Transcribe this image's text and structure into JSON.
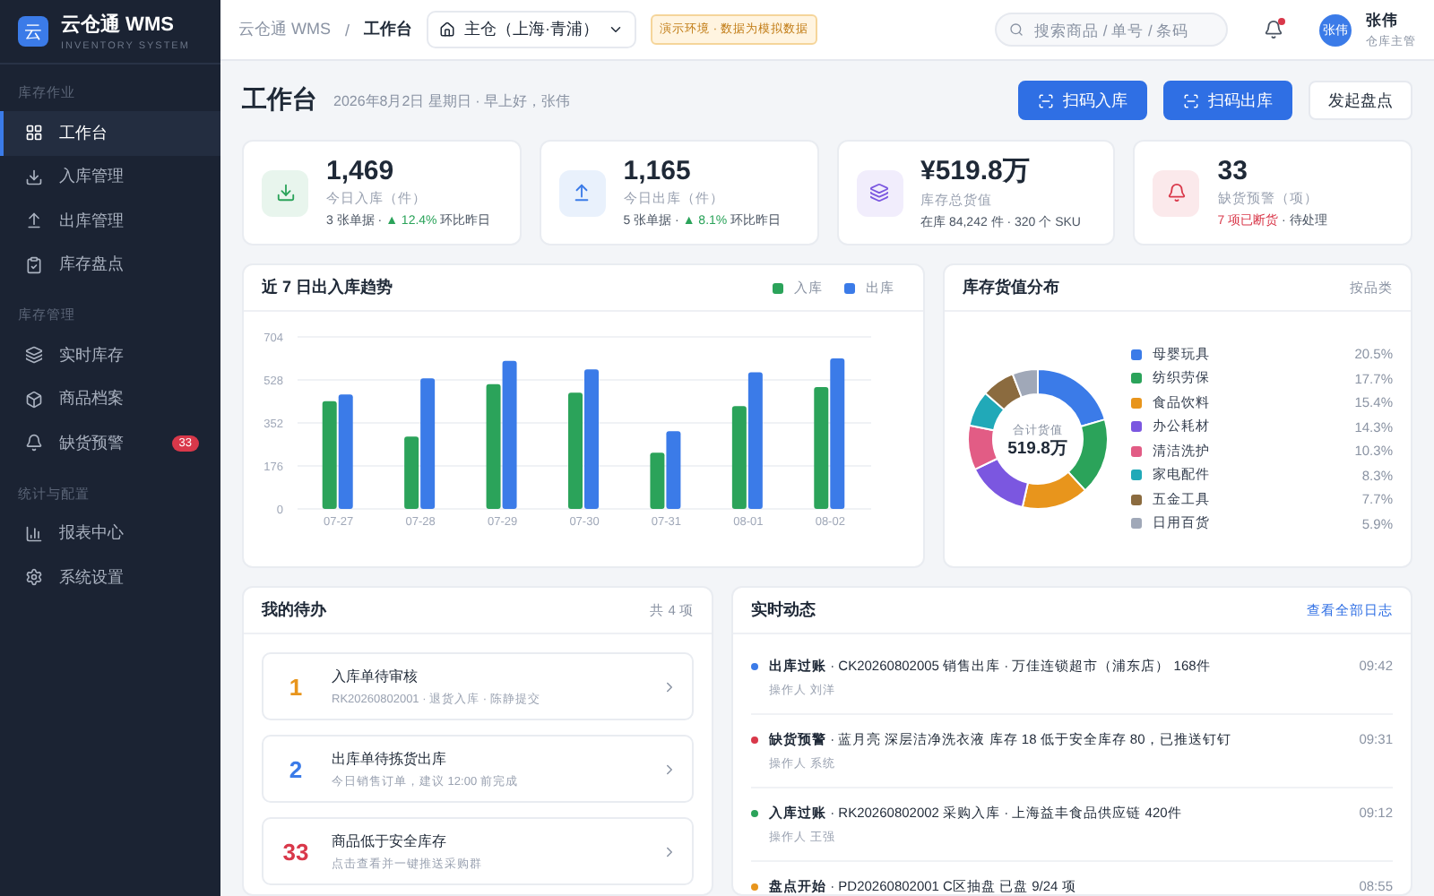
{
  "sidebar": {
    "logo": "云",
    "name": "云仓通 WMS",
    "subtitle": "INVENTORY SYSTEM",
    "sections": [
      {
        "label": "库存作业",
        "items": [
          {
            "label": "工作台",
            "selected": true
          },
          {
            "label": "入库管理",
            "selected": false
          },
          {
            "label": "出库管理",
            "selected": false
          },
          {
            "label": "库存盘点",
            "selected": false
          }
        ]
      },
      {
        "label": "库存管理",
        "items": [
          {
            "label": "实时库存",
            "selected": false
          },
          {
            "label": "商品档案",
            "selected": false
          },
          {
            "label": "缺货预警",
            "selected": false,
            "badge": "33"
          }
        ]
      },
      {
        "label": "统计与配置",
        "items": [
          {
            "label": "报表中心",
            "selected": false
          },
          {
            "label": "系统设置",
            "selected": false
          }
        ]
      }
    ]
  },
  "topbar": {
    "breadcrumb": [
      "云仓通 WMS",
      "工作台"
    ],
    "breadcrumb_separator": "/",
    "warehouse": "主仓（上海·青浦）",
    "env_badge": "演示环境 · 数据为模拟数据",
    "search": {
      "placeholder": "搜索商品 / 单号 / 条码"
    },
    "unread": true,
    "user": {
      "avatar": "张伟",
      "name": "张伟",
      "role": "仓库主管"
    }
  },
  "header": {
    "title": "工作台",
    "subtitle": "2026年8月2日 星期日 · 早上好，张伟",
    "buttons": [
      {
        "label": "扫码入库",
        "kind": "primary"
      },
      {
        "label": "扫码出库",
        "kind": "primary"
      },
      {
        "label": "发起盘点",
        "kind": "secondary"
      }
    ]
  },
  "stats": [
    {
      "value": "1,469",
      "label": "今日入库（件）",
      "color": "#2ba35a",
      "note": "3 张单据 · ",
      "note_trend": "▲ 12.4%",
      "note_suffix": " 环比昨日"
    },
    {
      "value": "1,165",
      "label": "今日出库（件）",
      "color": "#3b7be8",
      "note": "5 张单据 · ",
      "note_trend": "▲ 8.1%",
      "note_suffix": " 环比昨日"
    },
    {
      "value": "¥519.8万",
      "label": "库存总货值",
      "color": "#7b57e0",
      "note": "在库 84,242 件 · 320 个 SKU"
    },
    {
      "value": "33",
      "label": "缺货预警（项）",
      "color": "#d9384a",
      "note_alert": "7 项已断货",
      "note_suffix": " · 待处理"
    }
  ],
  "trend": {
    "title": "近 7 日出入库趋势",
    "chart_data": {
      "type": "bar",
      "grid": true,
      "categories": [
        "07-27",
        "07-28",
        "07-29",
        "07-30",
        "07-31",
        "08-01",
        "08-02"
      ],
      "ylim": [
        0,
        704
      ],
      "yticks": [
        0,
        176,
        352,
        528,
        704
      ],
      "series": [
        {
          "name": "入库",
          "color": "#2ba35a",
          "values": [
            441,
            296,
            511,
            476,
            230,
            421,
            499
          ]
        },
        {
          "name": "出库",
          "color": "#3b7be8",
          "values": [
            468,
            534,
            606,
            571,
            318,
            559,
            616
          ]
        }
      ]
    }
  },
  "distribution": {
    "title": "库存货值分布",
    "aside": "按品类",
    "center_label": "合计货值",
    "center_value": "519.8万",
    "legend": [
      {
        "label": "母婴玩具",
        "share": "20.5%",
        "color": "#3b7be8"
      },
      {
        "label": "纺织劳保",
        "share": "17.7%",
        "color": "#2ba35a"
      },
      {
        "label": "食品饮料",
        "share": "15.4%",
        "color": "#e8951c"
      },
      {
        "label": "办公耗材",
        "share": "14.3%",
        "color": "#7b57e0"
      },
      {
        "label": "清洁洗护",
        "share": "10.3%",
        "color": "#e25c85"
      },
      {
        "label": "家电配件",
        "share": "8.3%",
        "color": "#21a9b8"
      },
      {
        "label": "五金工具",
        "share": "7.7%",
        "color": "#8b6b3f"
      },
      {
        "label": "日用百货",
        "share": "5.9%",
        "color": "#a0a8b8"
      }
    ]
  },
  "todo": {
    "title": "我的待办",
    "count": "共 4 项",
    "items": [
      {
        "number": "1",
        "color": "#e8951c",
        "title": "入库单待审核",
        "subtitle": "RK20260802001 · 退货入库 · 陈静提交"
      },
      {
        "number": "2",
        "color": "#3b7be8",
        "title": "出库单待拣货出库",
        "subtitle": "今日销售订单，建议 12:00 前完成"
      },
      {
        "number": "33",
        "color": "#d9384a",
        "title": "商品低于安全库存",
        "subtitle": "点击查看并一键推送采购群"
      }
    ]
  },
  "activity": {
    "title": "实时动态",
    "link": "查看全部日志",
    "items": [
      {
        "color": "#3b7be8",
        "text": "**出库过账** · CK20260802005 销售出库 · 万佳连锁超市（浦东店） 168件",
        "operator": "操作人 刘洋",
        "time": "09:42"
      },
      {
        "color": "#d9384a",
        "text": "**缺货预警** · 蓝月亮 深层洁净洗衣液 库存 18 低于安全库存 80，已推送钉钉",
        "operator": "操作人 系统",
        "time": "09:31"
      },
      {
        "color": "#2ba35a",
        "text": "**入库过账** · RK20260802002 采购入库 · 上海益丰食品供应链 420件",
        "operator": "操作人 王强",
        "time": "09:12"
      },
      {
        "color": "#e8951c",
        "text": "**盘点开始** · PD20260802001 C区抽盘 已盘 9/24 项",
        "time": "08:55"
      }
    ]
  }
}
